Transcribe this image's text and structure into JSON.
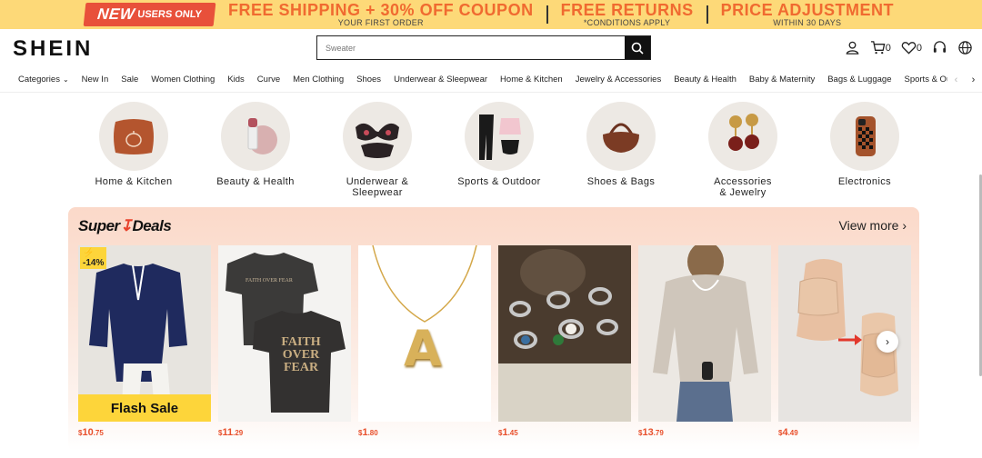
{
  "promo": {
    "new_big": "NEW",
    "new_small": "USERS ONLY",
    "shipping_main": "FREE SHIPPING + 30% OFF COUPON",
    "shipping_sub": "YOUR FIRST ORDER",
    "returns_main": "FREE RETURNS",
    "returns_sub": "*CONDITIONS APPLY",
    "price_main": "PRICE ADJUSTMENT",
    "price_sub": "WITHIN 30 DAYS"
  },
  "header": {
    "logo": "SHEIN",
    "search_placeholder": "Sweater",
    "cart_count": "0",
    "wishlist_count": "0"
  },
  "nav": {
    "items": [
      "Categories",
      "New In",
      "Sale",
      "Women Clothing",
      "Kids",
      "Curve",
      "Men Clothing",
      "Shoes",
      "Underwear & Sleepwear",
      "Home & Kitchen",
      "Jewelry & Accessories",
      "Beauty & Health",
      "Baby & Maternity",
      "Bags & Luggage",
      "Sports & Outdoor"
    ]
  },
  "categories": [
    {
      "label": "Home & Kitchen"
    },
    {
      "label": "Beauty & Health"
    },
    {
      "label": "Underwear & Sleepwear"
    },
    {
      "label": "Sports & Outdoor"
    },
    {
      "label": "Shoes & Bags"
    },
    {
      "label": "Accessories & Jewelry"
    },
    {
      "label": "Electronics"
    }
  ],
  "deals": {
    "title_a": "Super",
    "title_b": "Deals",
    "view_more": "View more",
    "discount": "-14%",
    "flash_sale": "Flash Sale",
    "products": [
      {
        "currency": "$",
        "int": "10",
        "dec": ".75"
      },
      {
        "currency": "$",
        "int": "11",
        "dec": ".29"
      },
      {
        "currency": "$",
        "int": "1",
        "dec": ".80"
      },
      {
        "currency": "$",
        "int": "1",
        "dec": ".45"
      },
      {
        "currency": "$",
        "int": "13",
        "dec": ".79"
      },
      {
        "currency": "$",
        "int": "4",
        "dec": ".49"
      }
    ],
    "tshirt_text": "FAITH OVER FEAR",
    "tshirt_small": "FAITH OVER FEAR",
    "pendant_letter": "A"
  },
  "colors": {
    "promo_bg": "#fdd978",
    "promo_accent": "#f06a30",
    "new_badge": "#e8503a",
    "price": "#e8502c",
    "flash": "#fdd53a"
  }
}
